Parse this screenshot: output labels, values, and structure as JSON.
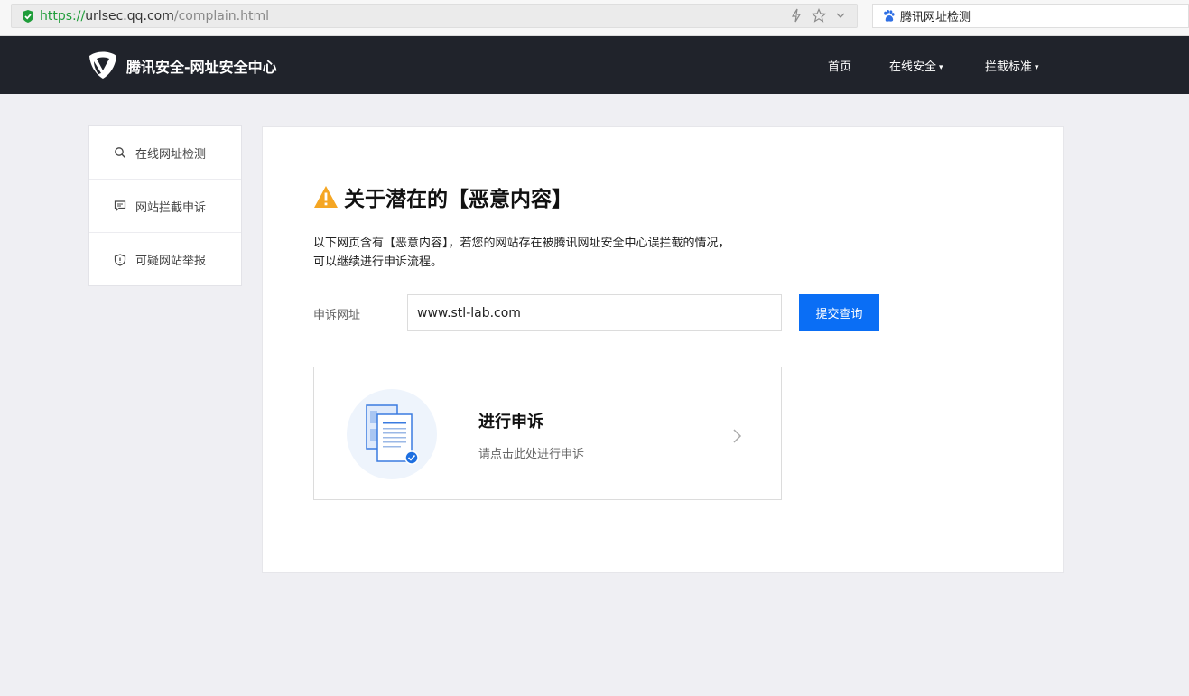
{
  "browser": {
    "url_scheme": "https://",
    "url_host": "urlsec.qq.com",
    "url_path": "/complain.html",
    "search_label": "腾讯网址检测",
    "icons": [
      "shield-check-icon",
      "flash-icon",
      "star-icon",
      "chevron-down-icon",
      "baidu-paw-icon"
    ]
  },
  "header": {
    "brand": "腾讯安全-网址安全中心",
    "nav": [
      {
        "label": "首页"
      },
      {
        "label": "在线安全",
        "caret": "▾"
      },
      {
        "label": "拦截标准",
        "caret": "▾"
      }
    ]
  },
  "sidebar": {
    "items": [
      {
        "label": "在线网址检测",
        "icon": "search-icon"
      },
      {
        "label": "网站拦截申诉",
        "icon": "comment-icon"
      },
      {
        "label": "可疑网站举报",
        "icon": "shield-icon"
      }
    ]
  },
  "main": {
    "title": "关于潜在的【恶意内容】",
    "desc_line1": "以下网页含有【恶意内容】，若您的网站存在被腾讯网址安全中心误拦截的情况，",
    "desc_line2": "可以继续进行申诉流程。",
    "form_label": "申诉网址",
    "form_value": "www.stl-lab.com",
    "submit_label": "提交查询",
    "appeal_title": "进行申诉",
    "appeal_subtitle": "请点击此处进行申诉"
  },
  "colors": {
    "header_bg": "#20232b",
    "accent": "#0a6ef5",
    "warning": "#f5a623",
    "page_bg": "#efeff3"
  }
}
